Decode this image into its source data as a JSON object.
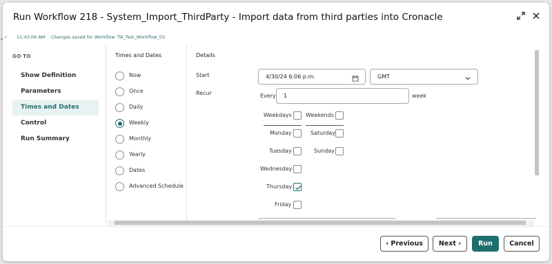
{
  "dialog": {
    "title": "Run Workflow 218 - System_Import_ThirdParty - Import data from third parties into Cronacle",
    "expand_icon": "expand-icon",
    "close_icon": "close-icon"
  },
  "status": {
    "time": "11:43:06 AM",
    "message": "Changes saved for Workflow 'TA_Test_Workflow_01'"
  },
  "sidebar": {
    "heading": "GO TO",
    "items": [
      {
        "label": "Show Definition"
      },
      {
        "label": "Parameters"
      },
      {
        "label": "Times and Dates"
      },
      {
        "label": "Control"
      },
      {
        "label": "Run Summary"
      }
    ]
  },
  "times": {
    "heading": "Times and Dates",
    "options": [
      {
        "label": "Now"
      },
      {
        "label": "Once"
      },
      {
        "label": "Daily"
      },
      {
        "label": "Weekly"
      },
      {
        "label": "Monthly"
      },
      {
        "label": "Yearly"
      },
      {
        "label": "Dates"
      },
      {
        "label": "Advanced Schedule"
      }
    ],
    "selected": "Weekly"
  },
  "details": {
    "heading": "Details",
    "start_label": "Start",
    "start_value": "4/30/24 6:06 p.m.",
    "timezone": "GMT",
    "recur_label": "Recur",
    "every_label": "Every",
    "every_value": "1",
    "unit": "week",
    "weekdays_label": "Weekdays",
    "weekends_label": "Weekends",
    "days": {
      "monday": "Monday",
      "tuesday": "Tuesday",
      "wednesday": "Wednesday",
      "thursday": "Thursday",
      "friday": "Friday",
      "saturday": "Saturday",
      "sunday": "Sunday"
    },
    "checked_days": [
      "Thursday"
    ]
  },
  "footer": {
    "previous": "Previous",
    "next": "Next",
    "run": "Run",
    "cancel": "Cancel"
  },
  "colors": {
    "accent": "#1f6e6e",
    "active_bg": "#e6f3f2"
  }
}
